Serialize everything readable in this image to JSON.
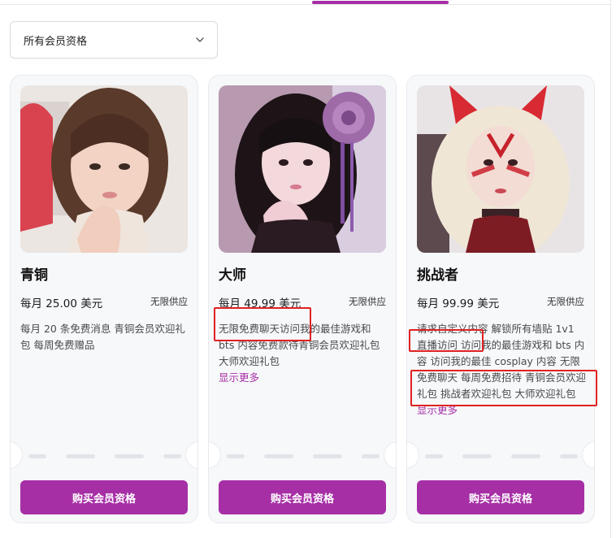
{
  "filter": {
    "selected": "所有会员资格"
  },
  "tiers": [
    {
      "name": "青铜",
      "price": "每月 25.00 美元",
      "supply": "无限供应",
      "description": "每月 20 条免费消息 青铜会员欢迎礼包 每周免费赠品",
      "show_more": "",
      "buy_label": "购买会员资格"
    },
    {
      "name": "大师",
      "price": "每月 49.99 美元",
      "supply": "无限供应",
      "description": "无限免费聊天访问我的最佳游戏和 bts 内容免费款待青铜会员欢迎礼包大师欢迎礼包",
      "show_more": "显示更多",
      "buy_label": "购买会员资格"
    },
    {
      "name": "挑战者",
      "price": "每月 99.99 美元",
      "supply": "无限供应",
      "description": "请求自定义内容 解锁所有墙贴 1v1 直播访问 访问我的最佳游戏和 bts 内容 访问我的最佳 cosplay 内容 无限免费聊天 每周免费招待 青铜会员欢迎礼包 挑战者欢迎礼包 大师欢迎礼包",
      "show_more": "显示更多",
      "buy_label": "购买会员资格"
    }
  ],
  "colors": {
    "accent": "#a62fa6",
    "highlight": "#e02222"
  }
}
